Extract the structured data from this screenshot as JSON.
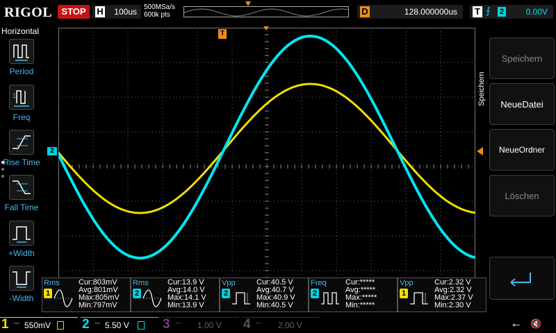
{
  "top": {
    "brand": "RIGOL",
    "run_state": "STOP",
    "timebase": {
      "letter": "H",
      "value": "100us"
    },
    "sample_rate": "500MSa/s",
    "memory_depth": "600k pts",
    "delay": {
      "letter": "D",
      "value": "128.000000us"
    },
    "trigger": {
      "letter": "T",
      "edge_symbol": "⨍",
      "source": "2",
      "level": "0.00V"
    }
  },
  "left_menu": {
    "title": "Horizontal",
    "items": [
      {
        "label": "Period",
        "icon": "period-icon"
      },
      {
        "label": "Freq",
        "icon": "frequency-icon"
      },
      {
        "label": "Rise Time",
        "icon": "rise-time-icon"
      },
      {
        "label": "Fall Time",
        "icon": "fall-time-icon"
      },
      {
        "label": "+Width",
        "icon": "positive-width-icon"
      },
      {
        "label": "-Width",
        "icon": "negative-width-icon"
      }
    ]
  },
  "right_menu": {
    "title": "Speichern",
    "buttons": [
      {
        "label": "Speichern",
        "enabled": false
      },
      {
        "label": "NeueDatei",
        "enabled": true
      },
      {
        "label": "NeueOrdner",
        "enabled": true
      },
      {
        "label": "Löschen",
        "enabled": false
      }
    ],
    "back_icon": "enter-return-icon"
  },
  "markers": {
    "ch2_ground": "2",
    "trigger_pos": "T"
  },
  "measurements": [
    {
      "name": "Rms",
      "channel": "1",
      "cur_label": "Cur:",
      "cur": "803mV",
      "avg_label": "Avg:",
      "avg": "801mV",
      "max_label": "Max:",
      "max": "805mV",
      "min_label": "Min:",
      "min": "797mV",
      "icon": "sine-rms-icon"
    },
    {
      "name": "Rms",
      "channel": "2",
      "cur_label": "Cur:",
      "cur": "13.9 V",
      "avg_label": "Avg:",
      "avg": "14.0 V",
      "max_label": "Max:",
      "max": "14.1 V",
      "min_label": "Min:",
      "min": "13.9 V",
      "icon": "sine-rms-icon"
    },
    {
      "name": "Vpp",
      "channel": "2",
      "cur_label": "Cur:",
      "cur": "40.5 V",
      "avg_label": "Avg:",
      "avg": "40.7 V",
      "max_label": "Max:",
      "max": "40.9 V",
      "min_label": "Min:",
      "min": "40.5 V",
      "icon": "peak-to-peak-icon"
    },
    {
      "name": "Freq",
      "channel": "2",
      "cur_label": "Cur:",
      "cur": "*****",
      "avg_label": "Avg:",
      "avg": "*****",
      "max_label": "Max:",
      "max": "*****",
      "min_label": "Min:",
      "min": "*****",
      "icon": "frequency-pulse-icon"
    },
    {
      "name": "Vpp",
      "channel": "1",
      "cur_label": "Cur:",
      "cur": "2.32 V",
      "avg_label": "Avg:",
      "avg": "2.32 V",
      "max_label": "Max:",
      "max": "2.37 V",
      "min_label": "Min:",
      "min": "2.30 V",
      "icon": "peak-to-peak-icon"
    }
  ],
  "channels": [
    {
      "num": "1",
      "scale": "550mV",
      "color": "#f0e000",
      "active": true
    },
    {
      "num": "2",
      "scale": "5.50 V",
      "color": "#00e5f0",
      "active": true
    },
    {
      "num": "3",
      "scale": "1.00 V",
      "color": "#c030c0",
      "active": false
    },
    {
      "num": "4",
      "scale": "2.00 V",
      "color": "#3060e0",
      "active": false
    }
  ],
  "colors": {
    "ch1": "#f0e000",
    "ch2": "#00e5f0",
    "trigger": "#f08a1c",
    "stop": "#c41414",
    "menu_label": "#49b8ea"
  }
}
